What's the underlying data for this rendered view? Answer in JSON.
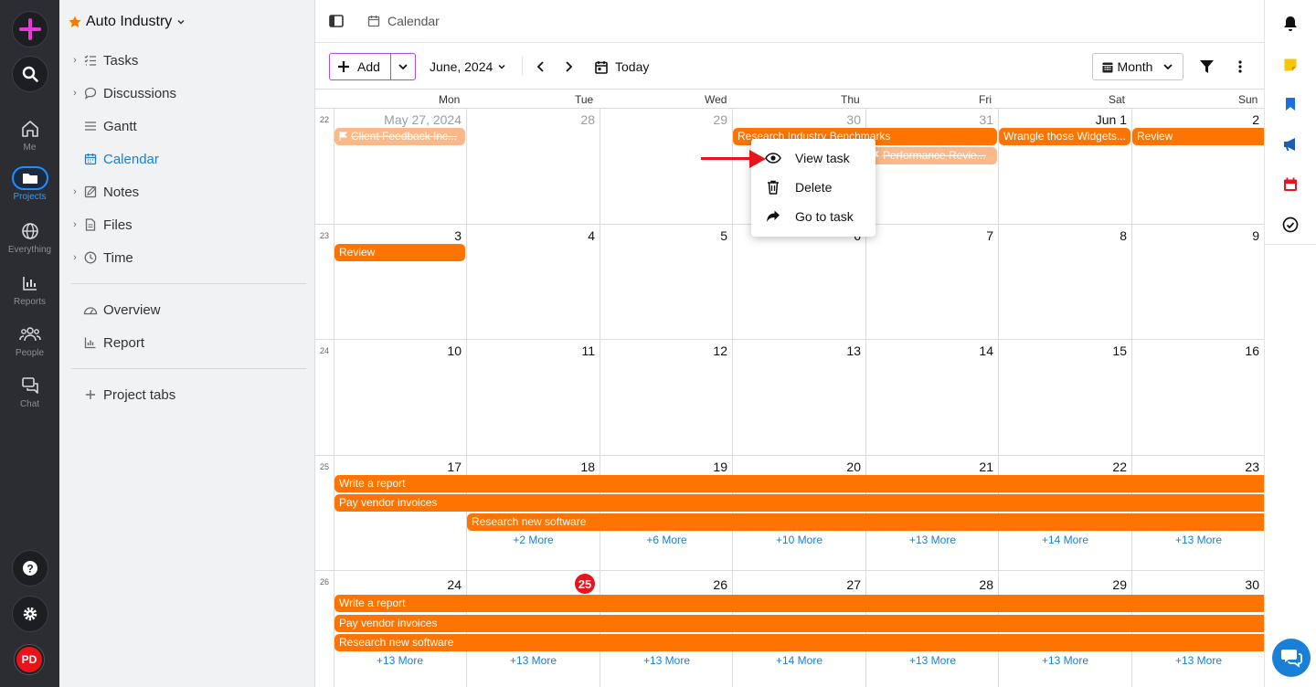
{
  "colors": {
    "accent": "#ff7400",
    "brand": "#1a7fd6",
    "rail": "#2b2d33",
    "today": "#e8131b",
    "add_border": "#b14ad9"
  },
  "rail": {
    "items": [
      {
        "label": "Me",
        "icon": "home-icon"
      },
      {
        "label": "Projects",
        "icon": "folder-icon"
      },
      {
        "label": "Everything",
        "icon": "globe-icon"
      },
      {
        "label": "Reports",
        "icon": "bar-chart-icon"
      },
      {
        "label": "People",
        "icon": "people-icon"
      },
      {
        "label": "Chat",
        "icon": "chat-icon"
      }
    ],
    "avatar_initials": "PD"
  },
  "sidebar": {
    "project_title": "Auto Industry",
    "items": [
      {
        "label": "Tasks"
      },
      {
        "label": "Discussions"
      },
      {
        "label": "Gantt"
      },
      {
        "label": "Calendar"
      },
      {
        "label": "Notes"
      },
      {
        "label": "Files"
      },
      {
        "label": "Time"
      },
      {
        "label": "Overview"
      },
      {
        "label": "Report"
      },
      {
        "label": "Project tabs"
      }
    ]
  },
  "header": {
    "breadcrumb": "Calendar"
  },
  "toolbar": {
    "add_label": "Add",
    "month_year": "June, 2024",
    "today_label": "Today",
    "view_label": "Month"
  },
  "calendar": {
    "weekdays": [
      "Mon",
      "Tue",
      "Wed",
      "Thu",
      "Fri",
      "Sat",
      "Sun"
    ],
    "weeks": [
      {
        "num": "22",
        "days": [
          "May 27, 2024",
          "28",
          "29",
          "30",
          "31",
          "Jun 1",
          "2"
        ]
      },
      {
        "num": "23",
        "days": [
          "3",
          "4",
          "5",
          "6",
          "7",
          "8",
          "9"
        ]
      },
      {
        "num": "24",
        "days": [
          "10",
          "11",
          "12",
          "13",
          "14",
          "15",
          "16"
        ]
      },
      {
        "num": "25",
        "days": [
          "17",
          "18",
          "19",
          "20",
          "21",
          "22",
          "23"
        ]
      },
      {
        "num": "26",
        "days": [
          "24",
          "25",
          "26",
          "27",
          "28",
          "29",
          "30"
        ]
      }
    ],
    "events": {
      "client_feedback": "Client Feedback Inc...",
      "research_benchmarks": "Research Industry Benchmarks",
      "wrangle_widgets": "Wrangle those Widgets...",
      "review_w22": "Review",
      "performance_review": "Performance Revie...",
      "review_w23": "Review",
      "write_report": "Write a report",
      "pay_invoices": "Pay vendor invoices",
      "research_software": "Research new software"
    },
    "more_w25": [
      "+2 More",
      "+6 More",
      "+10 More",
      "+13 More",
      "+14 More",
      "+13 More"
    ],
    "more_w26": [
      "+13 More",
      "+13 More",
      "+13 More",
      "+14 More",
      "+13 More",
      "+13 More",
      "+13 More"
    ]
  },
  "context_menu": {
    "items": [
      {
        "label": "View task"
      },
      {
        "label": "Delete"
      },
      {
        "label": "Go to task"
      }
    ]
  }
}
